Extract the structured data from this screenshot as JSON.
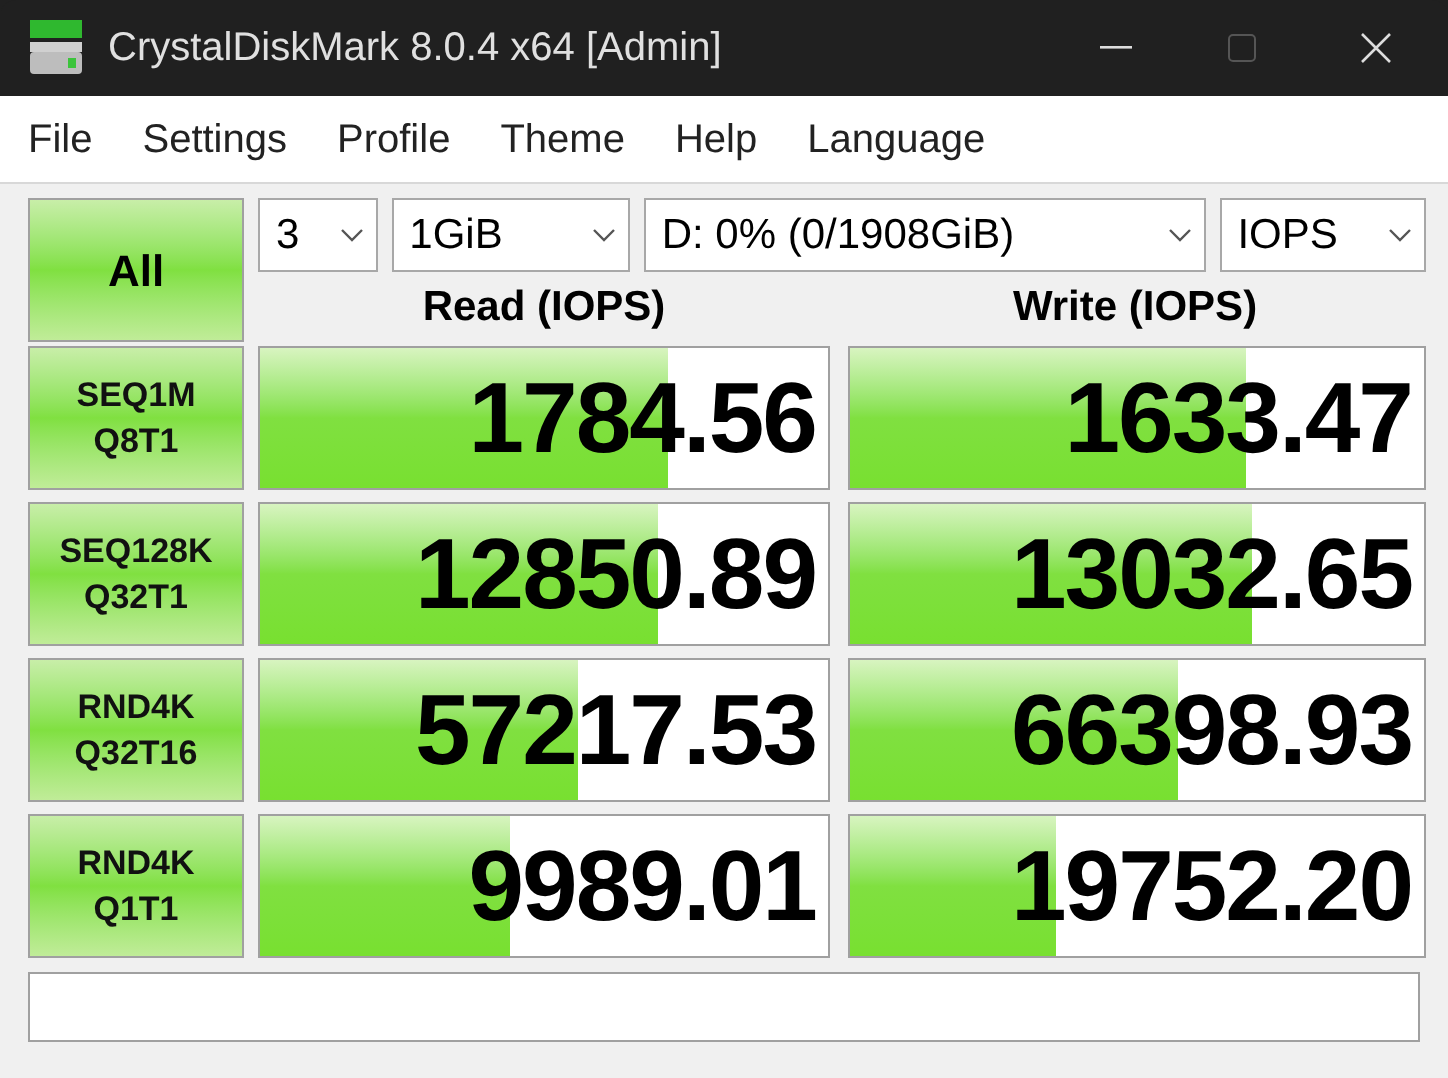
{
  "window": {
    "title": "CrystalDiskMark 8.0.4 x64 [Admin]"
  },
  "menu": [
    "File",
    "Settings",
    "Profile",
    "Theme",
    "Help",
    "Language"
  ],
  "all_button": "All",
  "selectors": [
    {
      "value": "3"
    },
    {
      "value": "1GiB"
    },
    {
      "value": "D: 0% (0/1908GiB)"
    },
    {
      "value": "IOPS"
    }
  ],
  "columns": [
    "Read (IOPS)",
    "Write (IOPS)"
  ],
  "rows": [
    {
      "test": [
        "SEQ1M",
        "Q8T1"
      ],
      "read": {
        "value": "1784.56",
        "level": 0.72
      },
      "write": {
        "value": "1633.47",
        "level": 0.69
      }
    },
    {
      "test": [
        "SEQ128K",
        "Q32T1"
      ],
      "read": {
        "value": "12850.89",
        "level": 0.7
      },
      "write": {
        "value": "13032.65",
        "level": 0.7
      }
    },
    {
      "test": [
        "RND4K",
        "Q32T16"
      ],
      "read": {
        "value": "57217.53",
        "level": 0.56
      },
      "write": {
        "value": "66398.93",
        "level": 0.57
      }
    },
    {
      "test": [
        "RND4K",
        "Q1T1"
      ],
      "read": {
        "value": "9989.01",
        "level": 0.44
      },
      "write": {
        "value": "19752.20",
        "level": 0.36
      }
    }
  ]
}
